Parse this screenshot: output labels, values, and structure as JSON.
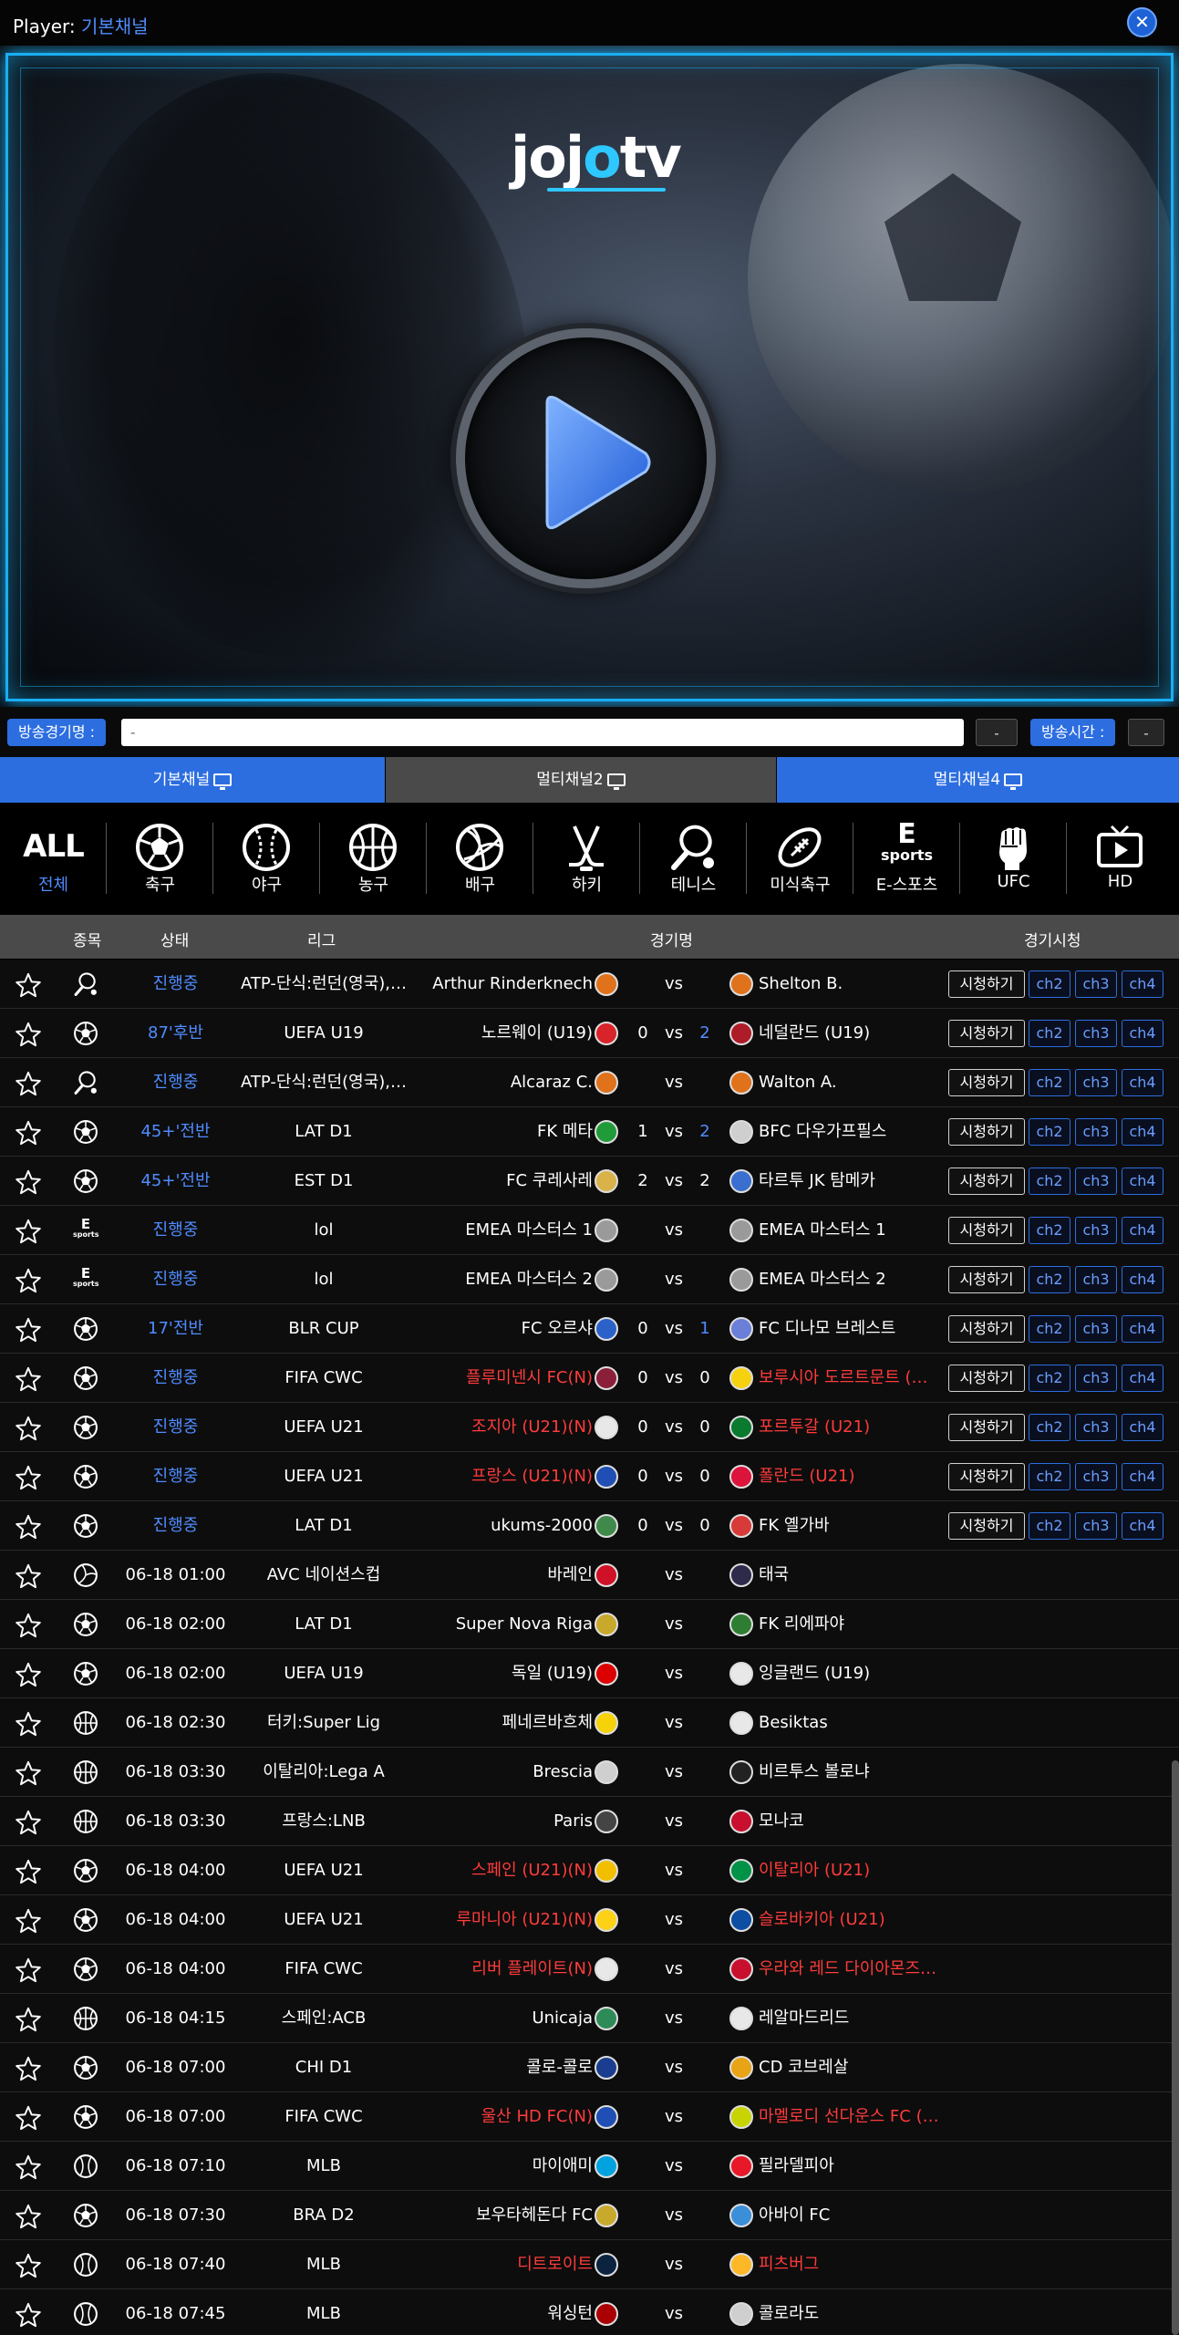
{
  "player": {
    "label": "Player:",
    "channel": "기본채널",
    "close": "✕"
  },
  "video": {
    "logo_left": "joj",
    "logo_o": "o",
    "logo_right": "tv"
  },
  "info": {
    "game_label": "방송경기명 :",
    "game_value": "-",
    "dash_value": "-",
    "time_label": "방송시간 :",
    "time_value": "-"
  },
  "tabs": [
    {
      "label": "기본채널",
      "icon": "monitor-icon"
    },
    {
      "label": "멀티채널2",
      "icon": "monitor-icon"
    },
    {
      "label": "멀티채널4",
      "icon": "grid-monitor-icon"
    }
  ],
  "categories": [
    {
      "label": "전체",
      "icon": "ALL"
    },
    {
      "label": "축구",
      "icon": "soccer-icon"
    },
    {
      "label": "야구",
      "icon": "baseball-icon"
    },
    {
      "label": "농구",
      "icon": "basketball-icon"
    },
    {
      "label": "배구",
      "icon": "volleyball-icon"
    },
    {
      "label": "하키",
      "icon": "hockey-icon"
    },
    {
      "label": "테니스",
      "icon": "tennis-icon"
    },
    {
      "label": "미식축구",
      "icon": "football-icon"
    },
    {
      "label": "E-스포츠",
      "icon": "esports-icon",
      "icon_top": "E",
      "icon_bottom": "sports"
    },
    {
      "label": "UFC",
      "icon": "fist-icon"
    },
    {
      "label": "HD",
      "icon": "tv-icon"
    }
  ],
  "table": {
    "headers": {
      "sport": "종목",
      "status": "상태",
      "league": "리그",
      "match": "경기명",
      "watch": "경기시청"
    },
    "watch_label": "시청하기",
    "channels": [
      "ch2",
      "ch3",
      "ch4"
    ],
    "vs": "vs",
    "rows": [
      {
        "sport": "tennis",
        "status": "진행중",
        "league": "ATP-단식:런던(영국),…",
        "home": "Arthur Rinderknech",
        "hs": "",
        "as": "",
        "away": "Shelton B.",
        "hc": "#e0721c",
        "ac": "#e0721c",
        "watch": true
      },
      {
        "sport": "soccer",
        "status": "87'후반",
        "league": "UEFA U19",
        "home": "노르웨이 (U19)",
        "hs": "0",
        "as": "2",
        "asblue": true,
        "away": "네덜란드 (U19)",
        "hc": "#d8232a",
        "ac": "#ae1c28",
        "watch": true
      },
      {
        "sport": "tennis",
        "status": "진행중",
        "league": "ATP-단식:런던(영국),…",
        "home": "Alcaraz C.",
        "hs": "",
        "as": "",
        "away": "Walton A.",
        "hc": "#e0721c",
        "ac": "#e0721c",
        "watch": true
      },
      {
        "sport": "soccer",
        "status": "45+'전반",
        "league": "LAT D1",
        "home": "FK 메타",
        "hs": "1",
        "as": "2",
        "asblue": true,
        "away": "BFC 다우가프필스",
        "hc": "#1f9b3a",
        "ac": "#cfcfcf",
        "watch": true
      },
      {
        "sport": "soccer",
        "status": "45+'전반",
        "league": "EST D1",
        "home": "FC 쿠레사레",
        "hs": "2",
        "as": "2",
        "away": "타르투 JK 탐메카",
        "hc": "#d9b34a",
        "ac": "#3a6fd0",
        "watch": true
      },
      {
        "sport": "esports",
        "status": "진행중",
        "league": "lol",
        "home": "EMEA 마스터스 1",
        "hs": "",
        "as": "",
        "away": "EMEA 마스터스 1",
        "hc": "#9a9a9a",
        "ac": "#9a9a9a",
        "watch": true
      },
      {
        "sport": "esports",
        "status": "진행중",
        "league": "lol",
        "home": "EMEA 마스터스 2",
        "hs": "",
        "as": "",
        "away": "EMEA 마스터스 2",
        "hc": "#9a9a9a",
        "ac": "#9a9a9a",
        "watch": true
      },
      {
        "sport": "soccer",
        "status": "17'전반",
        "league": "BLR CUP",
        "home": "FC 오르샤",
        "hs": "0",
        "as": "1",
        "asblue": true,
        "away": "FC 디나모 브레스트",
        "hc": "#2b62c9",
        "ac": "#6a7fd8",
        "watch": true
      },
      {
        "sport": "soccer",
        "status": "진행중",
        "league": "FIFA CWC",
        "home": "플루미넨시 FC(N)",
        "hs": "0",
        "as": "0",
        "away": "보루시아 도르트문트 (한…",
        "red": true,
        "hc": "#8b1f3a",
        "ac": "#f6d10f",
        "watch": true
      },
      {
        "sport": "soccer",
        "status": "진행중",
        "league": "UEFA U21",
        "home": "조지아 (U21)(N)",
        "hs": "0",
        "as": "0",
        "away": "포르투갈 (U21)",
        "red": true,
        "hc": "#e8e8e8",
        "ac": "#0a7a2f",
        "watch": true
      },
      {
        "sport": "soccer",
        "status": "진행중",
        "league": "UEFA U21",
        "home": "프랑스 (U21)(N)",
        "hs": "0",
        "as": "0",
        "away": "폴란드 (U21)",
        "red": true,
        "hc": "#1f4fb5",
        "ac": "#dc143c",
        "watch": true
      },
      {
        "sport": "soccer",
        "status": "진행중",
        "league": "LAT D1",
        "home": "ukums-2000",
        "hs": "0",
        "as": "0",
        "away": "FK 옐가바",
        "hc": "#3f8a4a",
        "ac": "#d83a3a",
        "watch": true
      },
      {
        "sport": "volleyball",
        "status": "06-18 01:00",
        "league": "AVC 네이션스컵",
        "home": "바레인",
        "hs": "",
        "as": "",
        "away": "태국",
        "hc": "#ce1126",
        "ac": "#2d2a4a",
        "watch": false
      },
      {
        "sport": "soccer",
        "status": "06-18 02:00",
        "league": "LAT D1",
        "home": "Super Nova Riga",
        "hs": "",
        "as": "",
        "away": "FK 리에파야",
        "hc": "#c8a92b",
        "ac": "#2e7d32",
        "watch": false
      },
      {
        "sport": "soccer",
        "status": "06-18 02:00",
        "league": "UEFA U19",
        "home": "독일 (U19)",
        "hs": "",
        "as": "",
        "away": "잉글랜드 (U19)",
        "hc": "#dd0000",
        "ac": "#e8e8e8",
        "watch": false
      },
      {
        "sport": "basketball",
        "status": "06-18 02:30",
        "league": "터키:Super Lig",
        "home": "페네르바흐체",
        "hs": "",
        "as": "",
        "away": "Besiktas",
        "hc": "#f5d20a",
        "ac": "#e8e8e8",
        "watch": false
      },
      {
        "sport": "basketball",
        "status": "06-18 03:30",
        "league": "이탈리아:Lega A",
        "home": "Brescia",
        "hs": "",
        "as": "",
        "away": "비르투스 볼로냐",
        "hc": "#cfcfcf",
        "ac": "#222222",
        "watch": false
      },
      {
        "sport": "basketball",
        "status": "06-18 03:30",
        "league": "프랑스:LNB",
        "home": "Paris",
        "hs": "",
        "as": "",
        "away": "모나코",
        "hc": "#444444",
        "ac": "#c8102e",
        "watch": false
      },
      {
        "sport": "soccer",
        "status": "06-18 04:00",
        "league": "UEFA U21",
        "home": "스페인 (U21)(N)",
        "hs": "",
        "as": "",
        "away": "이탈리아 (U21)",
        "red": true,
        "hc": "#f1bf00",
        "ac": "#009246",
        "watch": false
      },
      {
        "sport": "soccer",
        "status": "06-18 04:00",
        "league": "UEFA U21",
        "home": "루마니아 (U21)(N)",
        "hs": "",
        "as": "",
        "away": "슬로바키아 (U21)",
        "red": true,
        "hc": "#fcd116",
        "ac": "#0b4ea2",
        "watch": false
      },
      {
        "sport": "soccer",
        "status": "06-18 04:00",
        "league": "FIFA CWC",
        "home": "리버 플레이트(N)",
        "hs": "",
        "as": "",
        "away": "우라와 레드 다이아몬즈 …",
        "red": true,
        "hc": "#e8e8e8",
        "ac": "#c8102e",
        "watch": false
      },
      {
        "sport": "basketball",
        "status": "06-18 04:15",
        "league": "스페인:ACB",
        "home": "Unicaja",
        "hs": "",
        "as": "",
        "away": "레알마드리드",
        "hc": "#2e8b57",
        "ac": "#e8e8e8",
        "watch": false
      },
      {
        "sport": "soccer",
        "status": "06-18 07:00",
        "league": "CHI D1",
        "home": "콜로-콜로",
        "hs": "",
        "as": "",
        "away": "CD 코브레살",
        "hc": "#1a3d8f",
        "ac": "#e8a317",
        "watch": false
      },
      {
        "sport": "soccer",
        "status": "06-18 07:00",
        "league": "FIFA CWC",
        "home": "울산 HD FC(N)",
        "hs": "",
        "as": "",
        "away": "마멜로디 선다운스 FC (…",
        "red": true,
        "hc": "#1f4fb5",
        "ac": "#c8d400",
        "watch": false
      },
      {
        "sport": "baseball",
        "status": "06-18 07:10",
        "league": "MLB",
        "home": "마이애미",
        "hs": "",
        "as": "",
        "away": "필라델피아",
        "hc": "#00a3e0",
        "ac": "#e81828",
        "watch": false
      },
      {
        "sport": "soccer",
        "status": "06-18 07:30",
        "league": "BRA D2",
        "home": "보우타헤돈다 FC",
        "hs": "",
        "as": "",
        "away": "아바이 FC",
        "hc": "#c8a92b",
        "ac": "#3a8fd8",
        "watch": false
      },
      {
        "sport": "baseball",
        "status": "06-18 07:40",
        "league": "MLB",
        "home": "디트로이트",
        "hs": "",
        "as": "",
        "away": "피츠버그",
        "red": true,
        "hc": "#0c2340",
        "ac": "#fdb827",
        "watch": false
      },
      {
        "sport": "baseball",
        "status": "06-18 07:45",
        "league": "MLB",
        "home": "워싱턴",
        "hs": "",
        "as": "",
        "away": "콜로라도",
        "hc": "#ab0003",
        "ac": "#cfcfcf",
        "watch": false
      }
    ]
  }
}
